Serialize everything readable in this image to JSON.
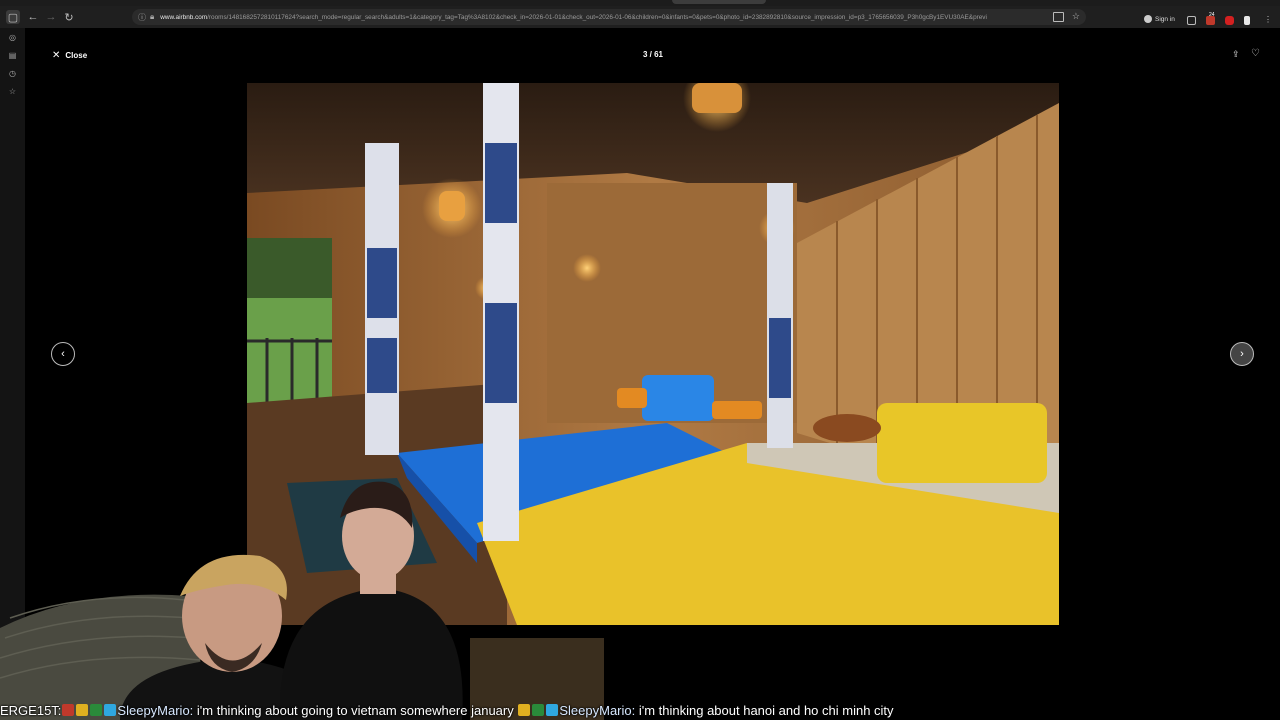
{
  "browser": {
    "url_host": "www.airbnb.com",
    "url_rest": "/rooms/1481682572810117624?search_mode=regular_search&adults=1&category_tag=Tag%3A8102&check_in=2026-01-01&check_out=2026-01-06&children=0&infants=0&pets=0&photo_id=2382892810&source_impression_id=p3_1765656039_P3h0gcBy1EVU30AE&previ",
    "sign_in_label": "Sign in",
    "badge_count": "24"
  },
  "gallery": {
    "close_label": "Close",
    "counter": "3 / 61",
    "photo_alt": "Wooden stilt house bedroom with blue and yellow beds"
  },
  "chat": {
    "prefix": "ERGE15T:",
    "user1": "SleepyMario:",
    "msg1": " i'm thinking about going to vietnam somewhere january ",
    "user2": "SleepyMario:",
    "msg2": " i'm thinking about hanoi and ho chi minh city"
  },
  "colors": {
    "accent_blue": "#1e6fd6",
    "bed_yellow": "#e9c22a"
  }
}
